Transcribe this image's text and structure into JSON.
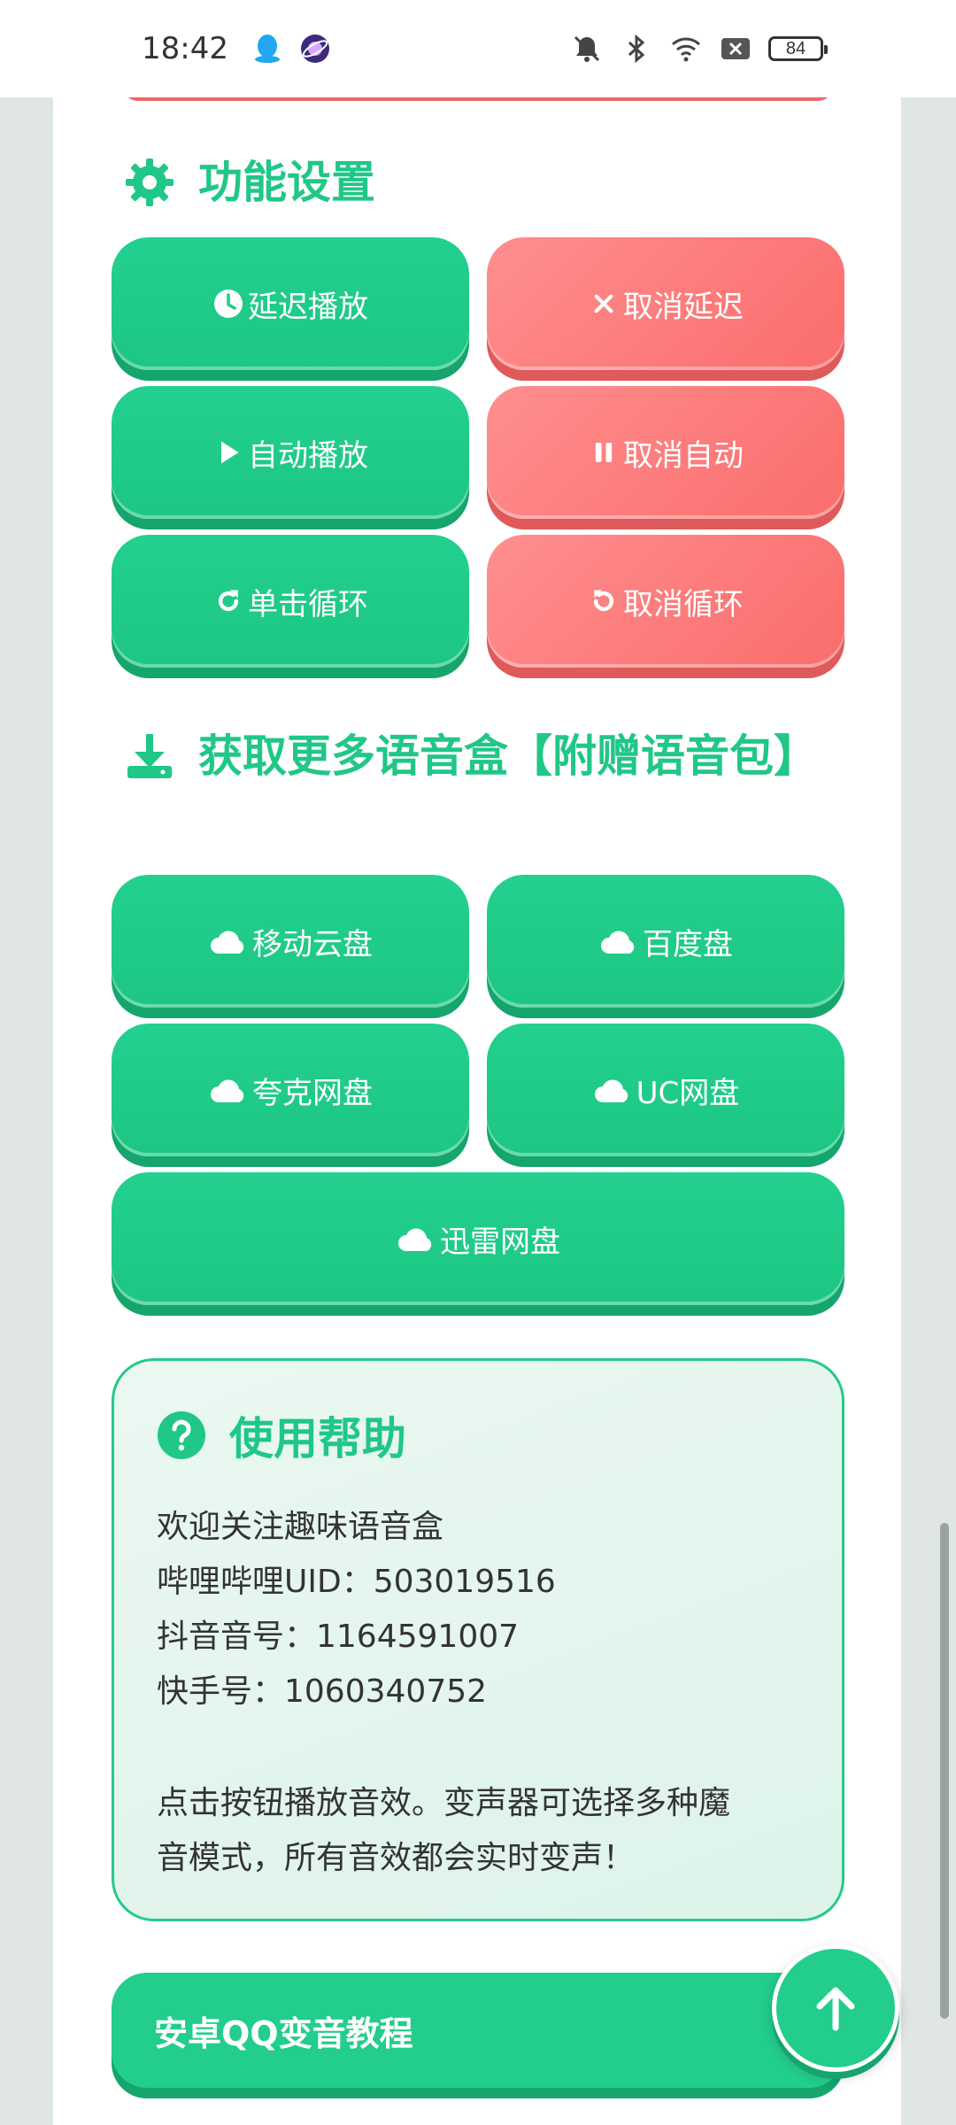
{
  "status_bar": {
    "time": "18:42",
    "battery": "84",
    "icons": [
      "qq-icon",
      "orbit-app-icon",
      "bell-off-icon",
      "bluetooth-icon",
      "wifi-icon",
      "close-box-icon"
    ]
  },
  "settings": {
    "title": "功能设置",
    "buttons": [
      {
        "label": "延迟播放",
        "icon": "clock-icon",
        "color": "#1fcb88"
      },
      {
        "label": "取消延迟",
        "icon": "close-icon",
        "color": "#fa7373"
      },
      {
        "label": "自动播放",
        "icon": "play-icon",
        "color": "#1fcb88"
      },
      {
        "label": "取消自动",
        "icon": "pause-icon",
        "color": "#fa7373"
      },
      {
        "label": "单击循环",
        "icon": "redo-icon",
        "color": "#1fcb88"
      },
      {
        "label": "取消循环",
        "icon": "undo-icon",
        "color": "#fa7373"
      }
    ]
  },
  "downloads": {
    "title": "获取更多语音盒【附赠语音包】",
    "buttons": [
      {
        "label": "移动云盘",
        "icon": "cloud-icon"
      },
      {
        "label": "百度盘",
        "icon": "cloud-icon"
      },
      {
        "label": "夸克网盘",
        "icon": "cloud-icon"
      },
      {
        "label": "UC网盘",
        "icon": "cloud-icon"
      },
      {
        "label": "迅雷网盘",
        "icon": "cloud-icon"
      }
    ]
  },
  "help": {
    "title": "使用帮助",
    "lines": [
      "欢迎关注趣味语音盒",
      "哔哩哔哩UID：503019516",
      "抖音音号：1164591007",
      "快手号：1060340752",
      "点击按钮播放音效。变声器可选择多种魔",
      "音模式，所有音效都会实时变声！"
    ]
  },
  "tutorial": {
    "label": "安卓QQ变音教程"
  },
  "colors": {
    "accent": "#20c787",
    "danger": "#fa7373"
  }
}
